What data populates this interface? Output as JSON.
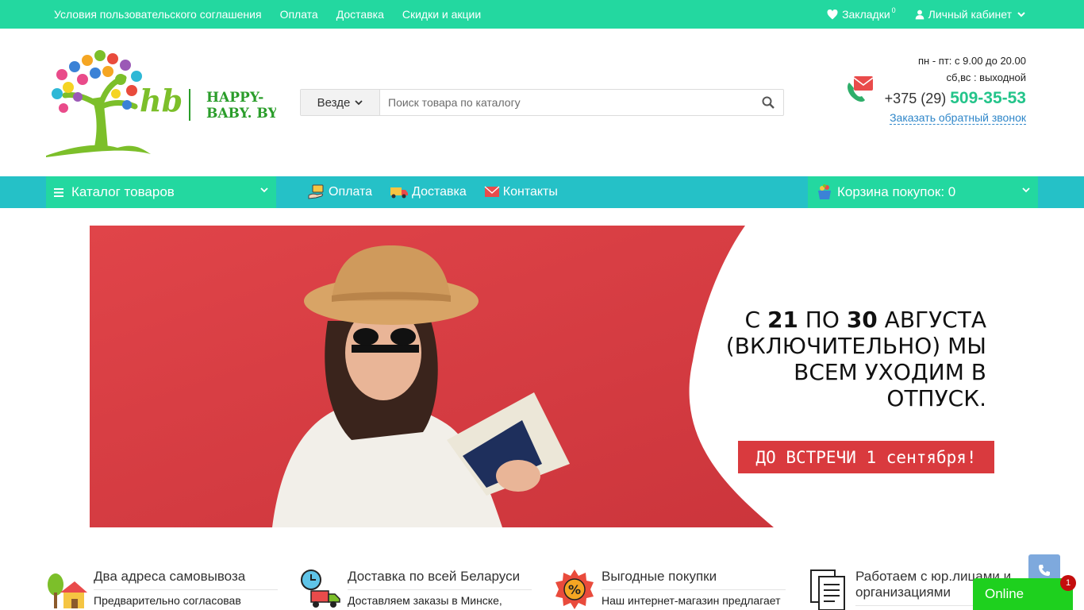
{
  "topbar": {
    "links": [
      "Условия пользовательского соглашения",
      "Оплата",
      "Доставка",
      "Скидки и акции"
    ],
    "bookmarks_label": "Закладки",
    "bookmarks_count": "0",
    "account_label": "Личный кабинет"
  },
  "logo": {
    "monogram": "hb",
    "brand_line1": "HAPPY-",
    "brand_line2": "BABY. BY"
  },
  "search": {
    "scope_label": "Везде",
    "placeholder": "Поиск товара по каталогу"
  },
  "contacts": {
    "hours_weekdays": "пн - пт: с 9.00 до 20.00",
    "hours_weekend": "сб,вс : выходной",
    "phone_prefix": "+375 (29)",
    "phone_number": "509-35-53",
    "callback_label": "Заказать обратный звонок"
  },
  "nav": {
    "catalog_label": "Каталог товаров",
    "links": [
      "Оплата",
      "Доставка",
      "Контакты"
    ],
    "cart_label": "Корзина покупок: 0"
  },
  "banner": {
    "line1_pre": "С ",
    "line1_d1": "21",
    "line1_mid": " ПО ",
    "line1_d2": "30",
    "line1_post": " АВГУСТА",
    "line2": "(ВКЛЮЧИТЕЛЬНО) МЫ",
    "line3": "ВСЕМ УХОДИМ В ОТПУСК.",
    "cta": "ДО ВСТРЕЧИ 1 сентября!"
  },
  "features": [
    {
      "title": "Два адреса самовывоза",
      "desc": "Предварительно согласовав"
    },
    {
      "title": "Доставка по всей Беларуси",
      "desc": "Доставляем заказы в Минске,"
    },
    {
      "title": "Выгодные покупки",
      "desc": "Наш интернет-магазин предлагает"
    },
    {
      "title": "Работаем с юр.лицами и организациями",
      "desc": ""
    }
  ],
  "widgets": {
    "online_label": "Online",
    "online_badge": "1"
  },
  "colors": {
    "topbar": "#23d8a0",
    "navbar": "#25c1c7",
    "banner_red": "#d93a3e",
    "accent_green": "#23c48a",
    "link_blue": "#2e86c9"
  }
}
